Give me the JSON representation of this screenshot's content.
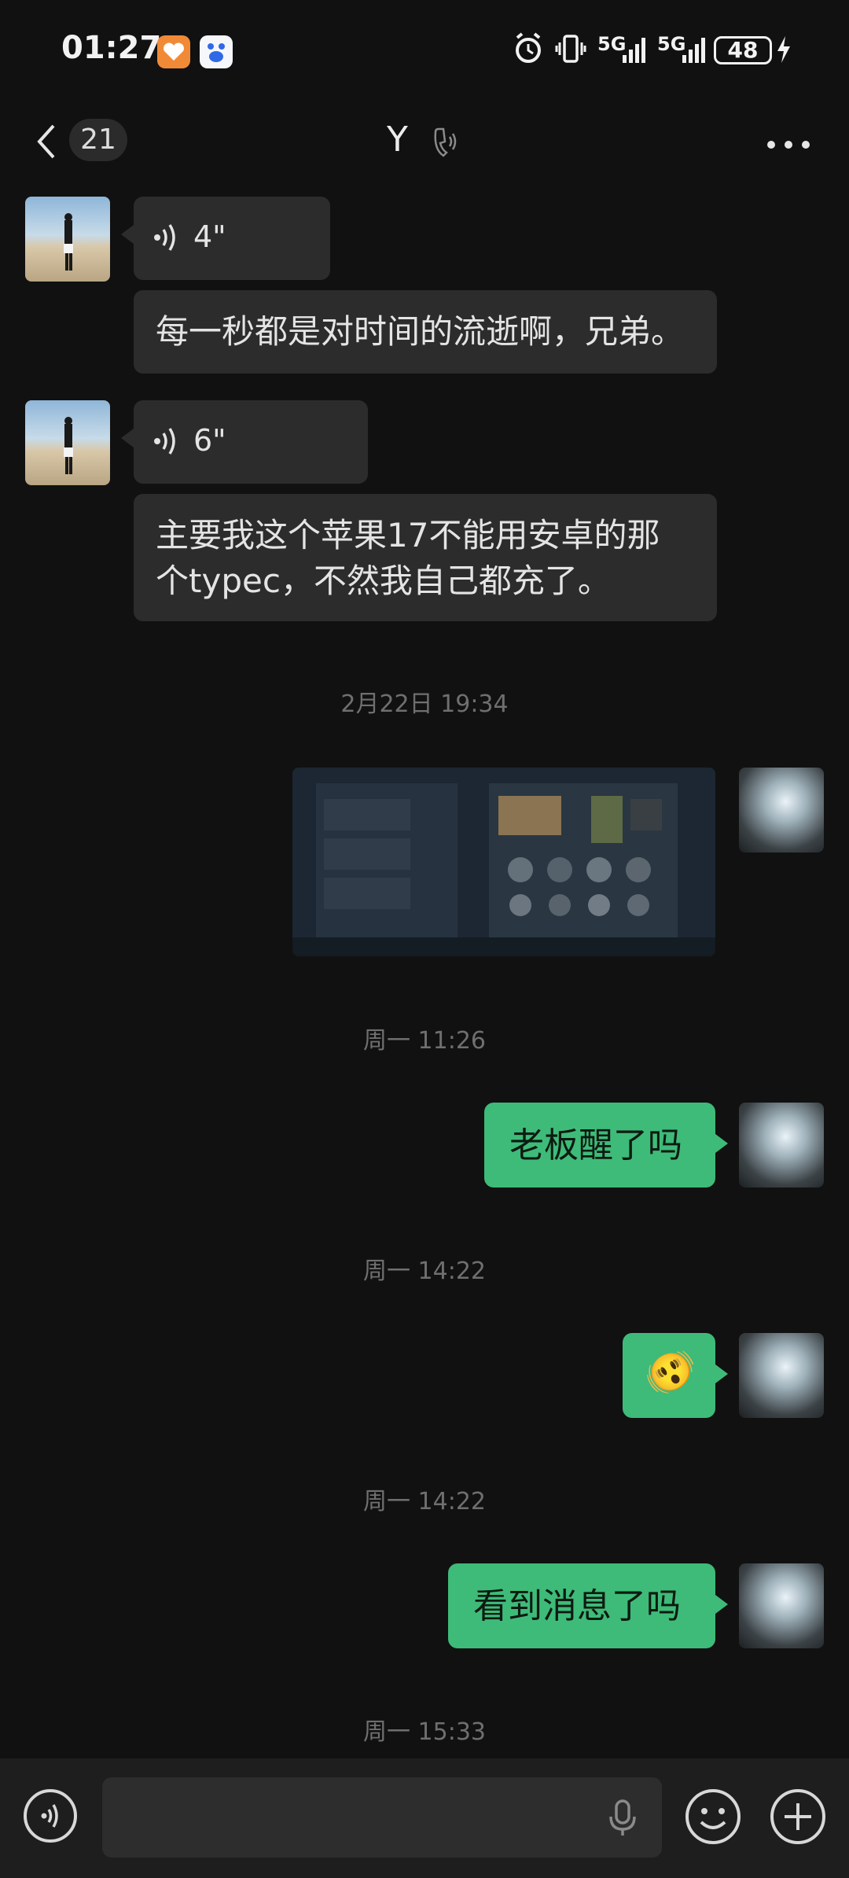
{
  "status_bar": {
    "time": "01:27",
    "network_1": "5G",
    "network_2": "5G",
    "battery": "48"
  },
  "header": {
    "unread_count": "21",
    "title": "Y"
  },
  "messages": [
    {
      "type": "voice",
      "direction": "in",
      "duration": "4\""
    },
    {
      "type": "text",
      "direction": "in",
      "text": "每一秒都是对时间的流逝啊，兄弟。"
    },
    {
      "type": "voice",
      "direction": "in",
      "duration": "6\""
    },
    {
      "type": "text",
      "direction": "in",
      "text_line1": "主要我这个苹果17不能用安卓的那",
      "text_line2": "个typec，不然我自己都充了。"
    },
    {
      "type": "timestamp",
      "text": "2月22日 19:34"
    },
    {
      "type": "image",
      "direction": "out"
    },
    {
      "type": "timestamp",
      "text": "周一 11:26"
    },
    {
      "type": "text",
      "direction": "out",
      "text": "老板醒了吗"
    },
    {
      "type": "timestamp",
      "text": "周一 14:22"
    },
    {
      "type": "emoji",
      "direction": "out",
      "text": "🫨"
    },
    {
      "type": "timestamp",
      "text": "周一 14:22"
    },
    {
      "type": "text",
      "direction": "out",
      "text": "看到消息了吗"
    },
    {
      "type": "timestamp",
      "text": "周一 15:33"
    }
  ],
  "input": {
    "placeholder": ""
  },
  "colors": {
    "background": "#111111",
    "outgoing_bubble": "#3ebb78",
    "incoming_bubble": "#2c2c2c"
  }
}
